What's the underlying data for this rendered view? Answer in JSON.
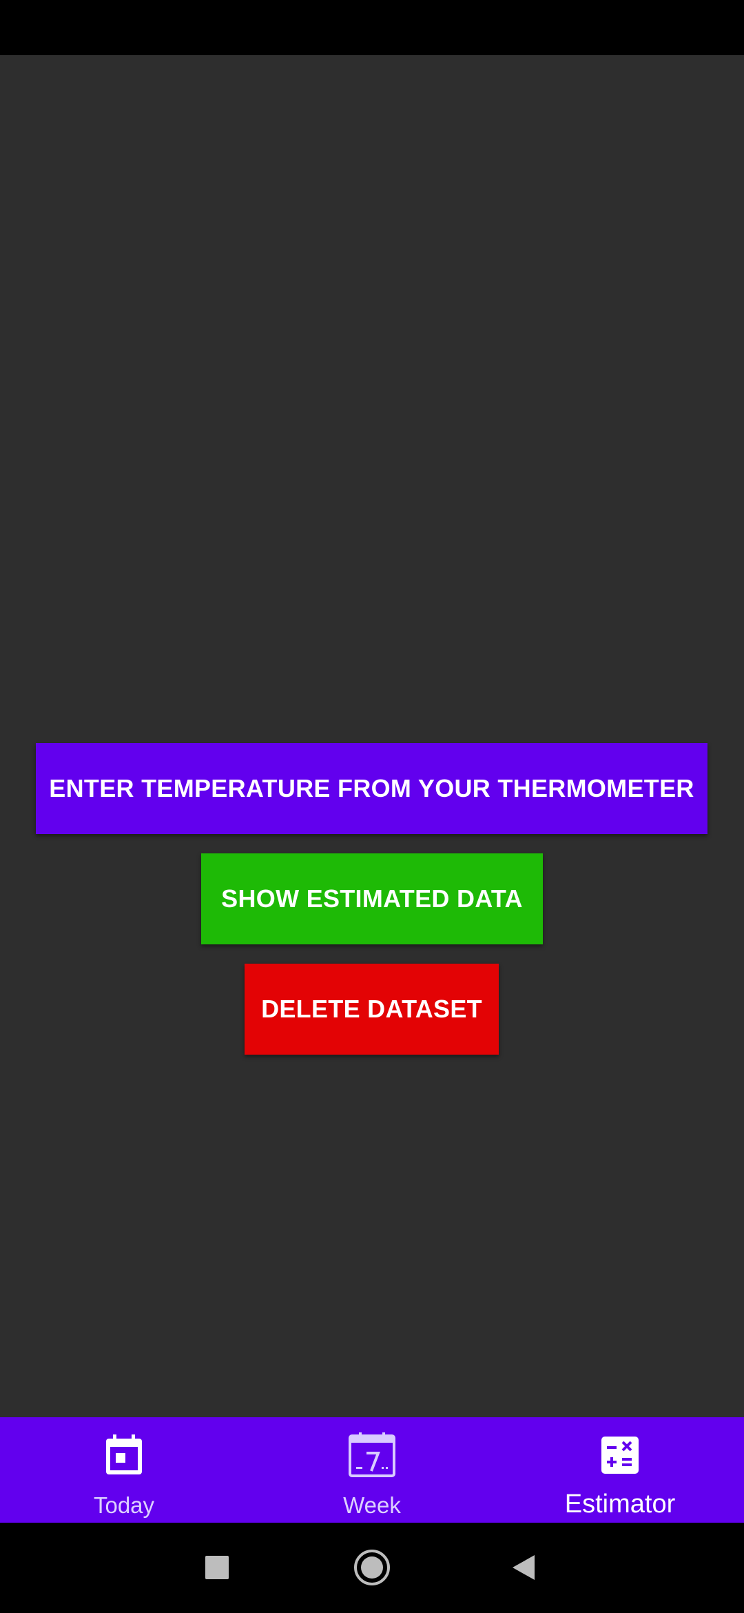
{
  "actions": {
    "enter_temperature_label": "ENTER TEMPERATURE FROM YOUR THERMOMETER",
    "show_estimated_label": "SHOW ESTIMATED DATA",
    "delete_dataset_label": "DELETE DATASET"
  },
  "bottom_nav": {
    "items": [
      {
        "label": "Today",
        "icon": "calendar-today-icon",
        "selected": false
      },
      {
        "label": "Week",
        "icon": "calendar-week-icon",
        "selected": false
      },
      {
        "label": "Estimator",
        "icon": "calculator-icon",
        "selected": true
      }
    ]
  },
  "system_nav": {
    "recents_icon": "square-recents-icon",
    "home_icon": "circle-home-icon",
    "back_icon": "triangle-back-icon"
  },
  "colors": {
    "primary": "#6200ee",
    "background": "#2e2e2e",
    "show_button": "#1eba06",
    "delete_button": "#e30305"
  }
}
